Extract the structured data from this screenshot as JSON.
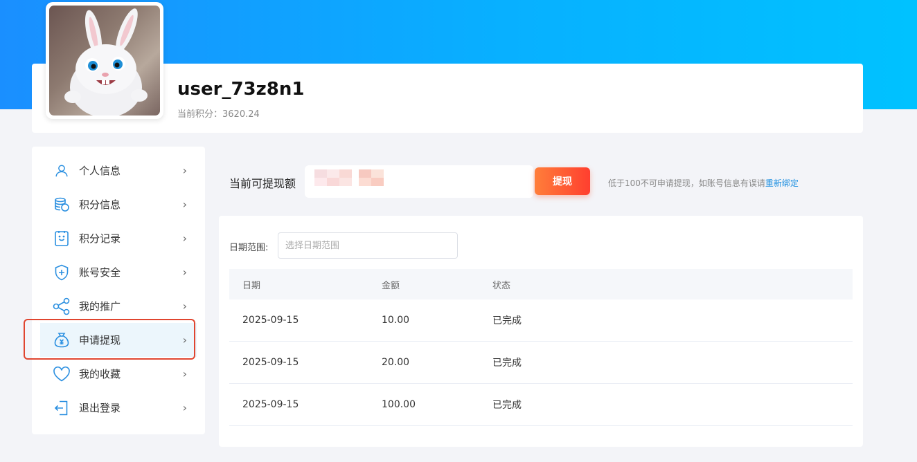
{
  "profile": {
    "username": "user_73z8n1",
    "points_label": "当前积分：",
    "points_value": "3620.24"
  },
  "sidebar": {
    "items": [
      {
        "label": "个人信息",
        "icon": "user-icon"
      },
      {
        "label": "积分信息",
        "icon": "coins-icon"
      },
      {
        "label": "积分记录",
        "icon": "record-icon"
      },
      {
        "label": "账号安全",
        "icon": "shield-icon"
      },
      {
        "label": "我的推广",
        "icon": "share-icon"
      },
      {
        "label": "申请提现",
        "icon": "money-bag-icon",
        "active": true
      },
      {
        "label": "我的收藏",
        "icon": "heart-icon"
      },
      {
        "label": "退出登录",
        "icon": "logout-icon"
      }
    ]
  },
  "withdraw": {
    "label": "当前可提现额",
    "button": "提现",
    "hint_text": "低于100不可申请提现，如账号信息有误请",
    "hint_link": "重新绑定"
  },
  "records": {
    "date_label": "日期范围:",
    "date_placeholder": "选择日期范围",
    "columns": [
      "日期",
      "金额",
      "状态"
    ],
    "rows": [
      [
        "2025-09-15",
        "10.00",
        "已完成"
      ],
      [
        "2025-09-15",
        "20.00",
        "已完成"
      ],
      [
        "2025-09-15",
        "100.00",
        "已完成"
      ]
    ]
  },
  "colors": {
    "accent": "#1e8fe0",
    "button_start": "#ff7e3a",
    "button_end": "#ff3f2f",
    "highlight": "#e0452f"
  }
}
